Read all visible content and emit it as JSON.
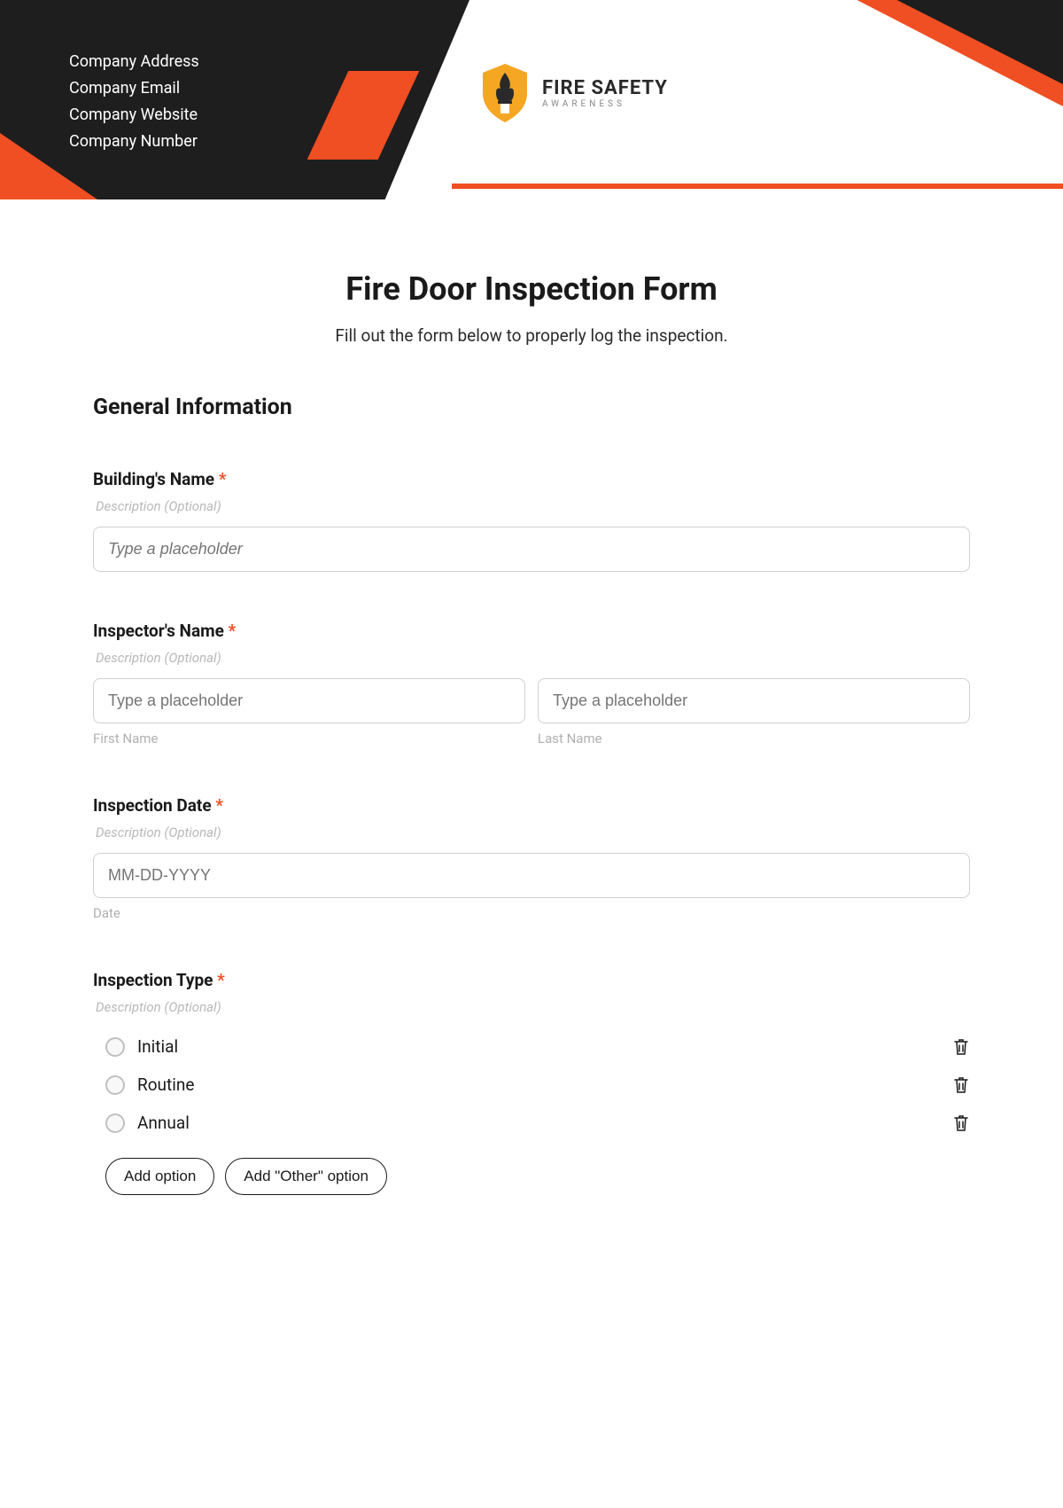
{
  "header": {
    "company_address": "Company Address",
    "company_email": "Company Email",
    "company_website": "Company Website",
    "company_number": "Company Number",
    "logo_title": "FIRE SAFETY",
    "logo_subtitle": "AWARENESS"
  },
  "form": {
    "title": "Fire Door Inspection Form",
    "subtitle": "Fill out the form below to properly log the inspection.",
    "section_heading": "General Information",
    "description_placeholder": "Description (Optional)",
    "building_name": {
      "label": "Building's Name",
      "placeholder": "Type a placeholder"
    },
    "inspector_name": {
      "label": "Inspector's Name",
      "first_placeholder": "Type a placeholder",
      "last_placeholder": "Type a placeholder",
      "first_sublabel": "First Name",
      "last_sublabel": "Last Name"
    },
    "inspection_date": {
      "label": "Inspection Date",
      "value": "MM-DD-YYYY",
      "sublabel": "Date"
    },
    "inspection_type": {
      "label": "Inspection Type",
      "options": [
        "Initial",
        "Routine",
        "Annual"
      ],
      "add_option": "Add option",
      "add_other": "Add \"Other\" option"
    }
  }
}
